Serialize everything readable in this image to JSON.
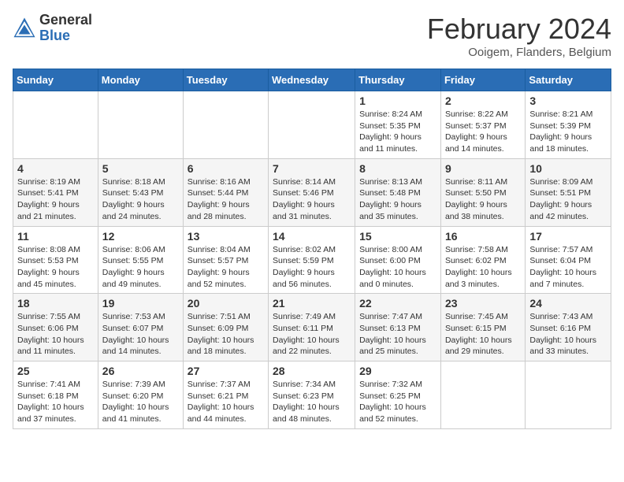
{
  "header": {
    "logo_general": "General",
    "logo_blue": "Blue",
    "month_title": "February 2024",
    "location": "Ooigem, Flanders, Belgium"
  },
  "days_of_week": [
    "Sunday",
    "Monday",
    "Tuesday",
    "Wednesday",
    "Thursday",
    "Friday",
    "Saturday"
  ],
  "weeks": [
    [
      {
        "day": "",
        "info": ""
      },
      {
        "day": "",
        "info": ""
      },
      {
        "day": "",
        "info": ""
      },
      {
        "day": "",
        "info": ""
      },
      {
        "day": "1",
        "info": "Sunrise: 8:24 AM\nSunset: 5:35 PM\nDaylight: 9 hours and 11 minutes."
      },
      {
        "day": "2",
        "info": "Sunrise: 8:22 AM\nSunset: 5:37 PM\nDaylight: 9 hours and 14 minutes."
      },
      {
        "day": "3",
        "info": "Sunrise: 8:21 AM\nSunset: 5:39 PM\nDaylight: 9 hours and 18 minutes."
      }
    ],
    [
      {
        "day": "4",
        "info": "Sunrise: 8:19 AM\nSunset: 5:41 PM\nDaylight: 9 hours and 21 minutes."
      },
      {
        "day": "5",
        "info": "Sunrise: 8:18 AM\nSunset: 5:43 PM\nDaylight: 9 hours and 24 minutes."
      },
      {
        "day": "6",
        "info": "Sunrise: 8:16 AM\nSunset: 5:44 PM\nDaylight: 9 hours and 28 minutes."
      },
      {
        "day": "7",
        "info": "Sunrise: 8:14 AM\nSunset: 5:46 PM\nDaylight: 9 hours and 31 minutes."
      },
      {
        "day": "8",
        "info": "Sunrise: 8:13 AM\nSunset: 5:48 PM\nDaylight: 9 hours and 35 minutes."
      },
      {
        "day": "9",
        "info": "Sunrise: 8:11 AM\nSunset: 5:50 PM\nDaylight: 9 hours and 38 minutes."
      },
      {
        "day": "10",
        "info": "Sunrise: 8:09 AM\nSunset: 5:51 PM\nDaylight: 9 hours and 42 minutes."
      }
    ],
    [
      {
        "day": "11",
        "info": "Sunrise: 8:08 AM\nSunset: 5:53 PM\nDaylight: 9 hours and 45 minutes."
      },
      {
        "day": "12",
        "info": "Sunrise: 8:06 AM\nSunset: 5:55 PM\nDaylight: 9 hours and 49 minutes."
      },
      {
        "day": "13",
        "info": "Sunrise: 8:04 AM\nSunset: 5:57 PM\nDaylight: 9 hours and 52 minutes."
      },
      {
        "day": "14",
        "info": "Sunrise: 8:02 AM\nSunset: 5:59 PM\nDaylight: 9 hours and 56 minutes."
      },
      {
        "day": "15",
        "info": "Sunrise: 8:00 AM\nSunset: 6:00 PM\nDaylight: 10 hours and 0 minutes."
      },
      {
        "day": "16",
        "info": "Sunrise: 7:58 AM\nSunset: 6:02 PM\nDaylight: 10 hours and 3 minutes."
      },
      {
        "day": "17",
        "info": "Sunrise: 7:57 AM\nSunset: 6:04 PM\nDaylight: 10 hours and 7 minutes."
      }
    ],
    [
      {
        "day": "18",
        "info": "Sunrise: 7:55 AM\nSunset: 6:06 PM\nDaylight: 10 hours and 11 minutes."
      },
      {
        "day": "19",
        "info": "Sunrise: 7:53 AM\nSunset: 6:07 PM\nDaylight: 10 hours and 14 minutes."
      },
      {
        "day": "20",
        "info": "Sunrise: 7:51 AM\nSunset: 6:09 PM\nDaylight: 10 hours and 18 minutes."
      },
      {
        "day": "21",
        "info": "Sunrise: 7:49 AM\nSunset: 6:11 PM\nDaylight: 10 hours and 22 minutes."
      },
      {
        "day": "22",
        "info": "Sunrise: 7:47 AM\nSunset: 6:13 PM\nDaylight: 10 hours and 25 minutes."
      },
      {
        "day": "23",
        "info": "Sunrise: 7:45 AM\nSunset: 6:15 PM\nDaylight: 10 hours and 29 minutes."
      },
      {
        "day": "24",
        "info": "Sunrise: 7:43 AM\nSunset: 6:16 PM\nDaylight: 10 hours and 33 minutes."
      }
    ],
    [
      {
        "day": "25",
        "info": "Sunrise: 7:41 AM\nSunset: 6:18 PM\nDaylight: 10 hours and 37 minutes."
      },
      {
        "day": "26",
        "info": "Sunrise: 7:39 AM\nSunset: 6:20 PM\nDaylight: 10 hours and 41 minutes."
      },
      {
        "day": "27",
        "info": "Sunrise: 7:37 AM\nSunset: 6:21 PM\nDaylight: 10 hours and 44 minutes."
      },
      {
        "day": "28",
        "info": "Sunrise: 7:34 AM\nSunset: 6:23 PM\nDaylight: 10 hours and 48 minutes."
      },
      {
        "day": "29",
        "info": "Sunrise: 7:32 AM\nSunset: 6:25 PM\nDaylight: 10 hours and 52 minutes."
      },
      {
        "day": "",
        "info": ""
      },
      {
        "day": "",
        "info": ""
      }
    ]
  ]
}
